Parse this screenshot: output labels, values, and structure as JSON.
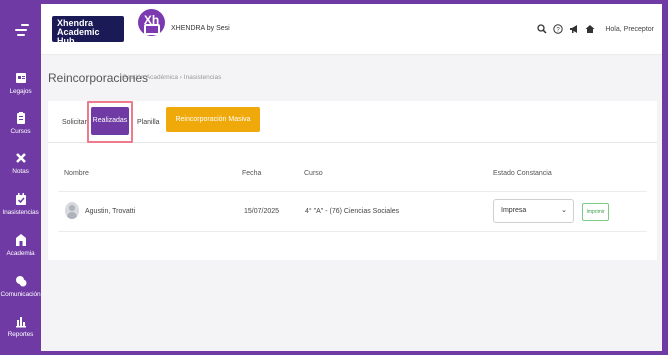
{
  "sidebar": {
    "items": [
      {
        "label": "Legajos",
        "icon": "id-card-icon"
      },
      {
        "label": "Cursos",
        "icon": "clipboard-icon"
      },
      {
        "label": "Notas",
        "icon": "cross-icon"
      },
      {
        "label": "Inasistencias",
        "icon": "calendar-check-icon"
      },
      {
        "label": "Academia",
        "icon": "school-icon"
      },
      {
        "label": "Comunicación",
        "icon": "chat-icon"
      },
      {
        "label": "Reportes",
        "icon": "bar-chart-icon"
      }
    ]
  },
  "header": {
    "logo_line1": "Xhendra",
    "logo_line2a": "Academic ",
    "logo_line2b": "Hub",
    "xh_logo_text": "Xh",
    "brand": "XHENDRA by Sesi",
    "greeting": "Hola, Preceptor",
    "icons": [
      "search-icon",
      "help-icon",
      "megaphone-icon",
      "home-icon"
    ]
  },
  "page": {
    "title": "Reincorporaciones",
    "breadcrumb": "Gestión Académica › Inasistencias"
  },
  "tabs": {
    "solicitar": "Solicitar",
    "realizadas": "Realizadas",
    "planilla": "Planilla",
    "masiva": "Reincorporación Masiva"
  },
  "table": {
    "headers": {
      "nombre": "Nombre",
      "fecha": "Fecha",
      "curso": "Curso",
      "estado": "Estado Constancia"
    },
    "row": {
      "nombre": "Agustin, Trovatti",
      "fecha": "15/07/2025",
      "curso": "4° \"A\" - (76) Ciencias Sociales",
      "estado": "Impresa",
      "action": "Imprimir"
    }
  },
  "colors": {
    "brand_purple": "#6f3aa3",
    "accent_orange": "#f0a90a",
    "highlight_pink": "#ef7a8c",
    "button_green": "#41a14c"
  }
}
